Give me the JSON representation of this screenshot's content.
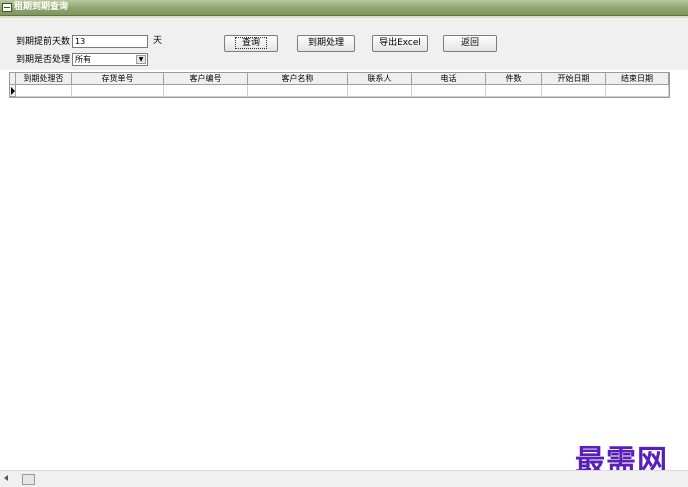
{
  "window": {
    "title": "租期到期查询"
  },
  "form": {
    "days_label": "到期提前天数",
    "days_value": "13",
    "days_unit": "天",
    "processed_label": "到期是否处理",
    "processed_value": "所有"
  },
  "buttons": {
    "query": "查询",
    "process": "到期处理",
    "export": "导出Excel",
    "back": "返回"
  },
  "grid": {
    "columns": [
      "到期处理否",
      "存货单号",
      "客户编号",
      "客户名称",
      "联系人",
      "电话",
      "件数",
      "开始日期",
      "结束日期"
    ]
  },
  "watermark": "最需网",
  "icons": {
    "window_icon": "window-menu-icon",
    "row_indicator": "row-pointer-icon",
    "scroll_left": "scroll-left-arrow-icon",
    "dropdown": "chevron-down-icon"
  }
}
